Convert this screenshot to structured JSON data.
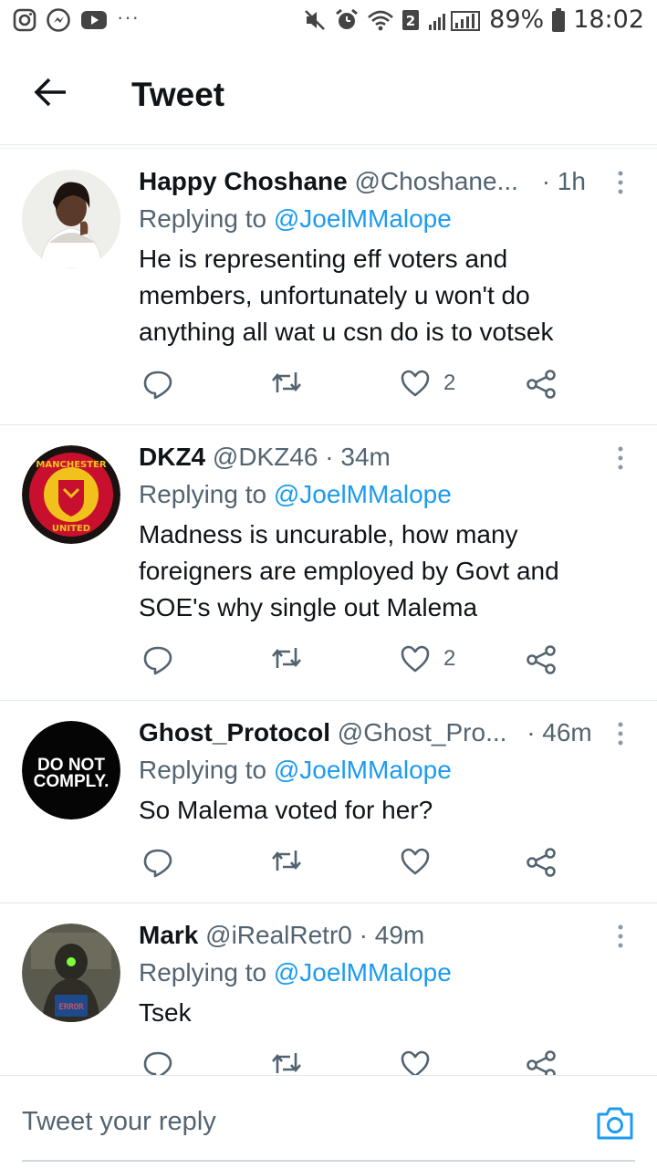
{
  "status_bar": {
    "time": "18:02",
    "battery": "89%",
    "left_icons": [
      "instagram-icon",
      "messenger-icon",
      "youtube-icon"
    ],
    "more": "···"
  },
  "header": {
    "title": "Tweet"
  },
  "tweets": [
    {
      "name": "Happy Choshane",
      "handle": "@Choshane...",
      "time": "· 1h",
      "replying_prefix": "Replying to ",
      "replying_to": "@JoelMMalope",
      "text": "He is representing eff voters and members, unfortunately u won't do anything all wat u csn do is to votsek",
      "likes": "2"
    },
    {
      "name": "DKZ4",
      "handle": "@DKZ46",
      "time": "· 34m",
      "replying_prefix": "Replying to ",
      "replying_to": "@JoelMMalope",
      "text": "Madness is uncurable, how many foreigners are employed by Govt and SOE's why single out Malema",
      "likes": "2",
      "avatar_text_top": "MANCHESTER",
      "avatar_text_bottom": "UNITED"
    },
    {
      "name": "Ghost_Protocol",
      "handle": "@Ghost_Pro...",
      "time": "· 46m",
      "replying_prefix": "Replying to ",
      "replying_to": "@JoelMMalope",
      "text": "So Malema voted for her?",
      "likes": "",
      "avatar_text_line1": "DO NOT",
      "avatar_text_line2": "COMPLY."
    },
    {
      "name": "Mark",
      "handle": "@iRealRetr0",
      "time": "· 49m",
      "replying_prefix": "Replying to ",
      "replying_to": "@JoelMMalope",
      "text": "Tsek",
      "likes": "",
      "avatar_text": "ERROR"
    }
  ],
  "composer": {
    "placeholder": "Tweet your reply"
  },
  "colors": {
    "link": "#1d9bf0",
    "secondary": "#536471",
    "text": "#0f1419"
  }
}
